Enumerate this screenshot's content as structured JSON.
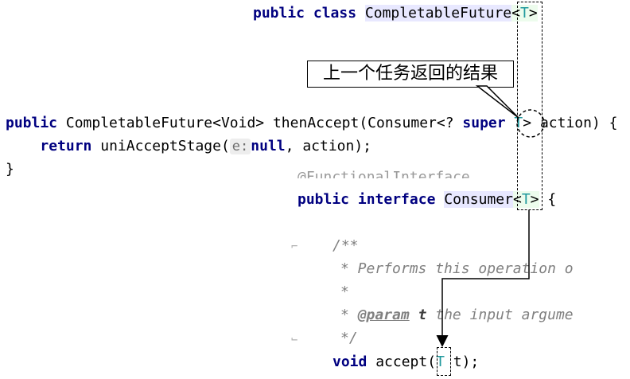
{
  "snippet1": {
    "kw_public": "public",
    "kw_class": "class",
    "class_name": "CompletableFuture",
    "lt": "<",
    "type_param": "T",
    "gt": ">"
  },
  "callout": {
    "text": "上一个任务返回的结果"
  },
  "snippet2": {
    "line1": {
      "kw_public": "public",
      "ret_type": "CompletableFuture<Void>",
      "method": "thenAccept(Consumer<?",
      "kw_super": "super",
      "type_param": "T",
      "gt": ">",
      "rest": "action) {"
    },
    "line2": {
      "kw_return": "return",
      "call": "uniAcceptStage(",
      "hint": "e:",
      "kw_null": "null",
      "rest": ", action);"
    },
    "line3": "}"
  },
  "snippet3": {
    "annotation_fragment": "@FunctionalInterface",
    "line1": {
      "kw_public": "public",
      "kw_interface": "interface",
      "iface_name": "Consumer",
      "lt": "<",
      "type_param": "T",
      "gt": ">",
      "brace": "{"
    },
    "javadoc": {
      "open": "/**",
      "desc": "* Performs this operation o",
      "star": "*",
      "param_prefix": "*",
      "param_tag": "@param",
      "param_name": "t",
      "param_desc": "the input argume",
      "close": "*/"
    },
    "method": {
      "kw_void": "void",
      "name": "accept(",
      "type_param": "T",
      "rest": "t);"
    }
  }
}
